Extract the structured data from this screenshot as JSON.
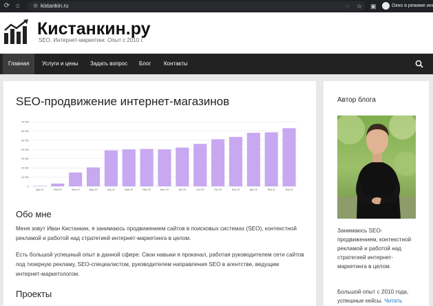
{
  "browser": {
    "url": "kistankin.ru",
    "incognito_label": "Окно в режиме инко"
  },
  "site": {
    "title": "Кистанкин.ру",
    "tagline": "SEO. Интернет-маркетинг. Опыт с 2010 г."
  },
  "nav": {
    "items": [
      {
        "label": "Главная",
        "active": true
      },
      {
        "label": "Услуги и цены",
        "active": false
      },
      {
        "label": "Задать вопрос",
        "active": false
      },
      {
        "label": "Блог",
        "active": false
      },
      {
        "label": "Контакты",
        "active": false
      }
    ]
  },
  "main": {
    "title": "SEO-продвижение интернет-магазинов",
    "about_heading": "Обо мне",
    "about_p1": "Меня зовут Иван Кистанкин, я занимаюсь продвижением сайтов в поисковых системах (SEO), контекстной рекламой и работой над стратегией интернет-маркетинга в целом.",
    "about_p2": "Есть большой успешный опыт в данной сфере. Свои навыки я прокачал, работая руководителем сети сайтов под тизерную рекламу, SEO-специалистом, руководителем направления SEO в агентстве, ведущим интернет-маркетологом.",
    "projects_heading": "Проекты"
  },
  "chart_data": {
    "type": "bar",
    "categories": [
      "Дек 19",
      "Янв 20",
      "Фев 20",
      "Мар 20",
      "Апр 20",
      "Май 20",
      "Июн 20",
      "Июл 20",
      "Авг 20",
      "Сен 20",
      "Окт 20",
      "Ноя 20",
      "Дек 20",
      "Янв 21",
      "Фев 21"
    ],
    "values": [
      500,
      3000,
      15000,
      20500,
      39000,
      40000,
      40500,
      40000,
      42000,
      46000,
      51000,
      53500,
      58000,
      58500,
      63000
    ],
    "y_ticks": [
      "0",
      "10 000",
      "20 000",
      "30 000",
      "40 000",
      "50 000",
      "60 000",
      "70 000"
    ],
    "ylim": [
      0,
      70000
    ],
    "bar_color": "#c7a8f1",
    "grid": true
  },
  "sidebar": {
    "title": "Автор блога",
    "text1": "Занимаюсь SEO-продвижением, контекстной рекламой и работой над стратегией интернет-маркетинга в целом.",
    "text2": "Большой опыт с 2010 года, успешные кейсы.",
    "read_link": "Читать"
  },
  "colors": {
    "nav_bg": "#222222",
    "nav_active_bg": "#3c3c3c",
    "link": "#1e73be",
    "page_bg": "#e9e9e9"
  }
}
